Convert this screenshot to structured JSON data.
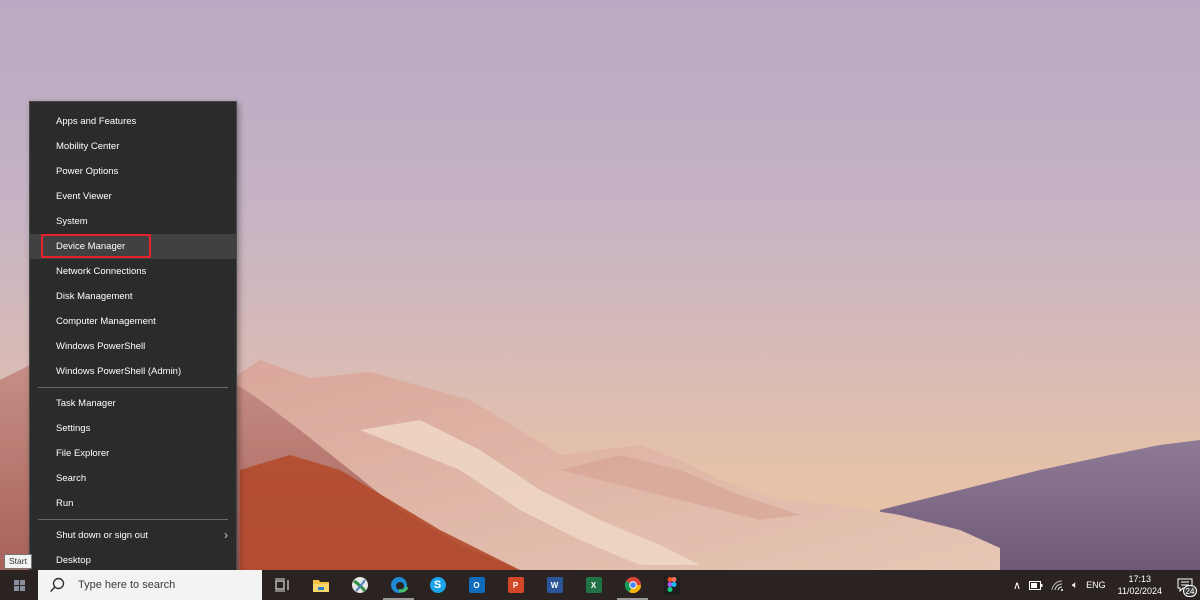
{
  "desktop": {
    "wallpaper": "landscape-hills-sunset"
  },
  "winx_menu": {
    "groups": [
      [
        {
          "label": "Apps and Features"
        },
        {
          "label": "Mobility Center"
        },
        {
          "label": "Power Options"
        },
        {
          "label": "Event Viewer"
        },
        {
          "label": "System"
        },
        {
          "label": "Device Manager",
          "highlighted": true
        },
        {
          "label": "Network Connections"
        },
        {
          "label": "Disk Management"
        },
        {
          "label": "Computer Management"
        },
        {
          "label": "Windows PowerShell"
        },
        {
          "label": "Windows PowerShell (Admin)"
        }
      ],
      [
        {
          "label": "Task Manager"
        },
        {
          "label": "Settings"
        },
        {
          "label": "File Explorer"
        },
        {
          "label": "Search"
        },
        {
          "label": "Run"
        }
      ],
      [
        {
          "label": "Shut down or sign out",
          "has_submenu": true
        },
        {
          "label": "Desktop"
        }
      ]
    ],
    "highlight_color": "#e8212b"
  },
  "tooltip": {
    "start": "Start"
  },
  "taskbar": {
    "search_placeholder": "Type here to search",
    "apps": [
      {
        "name": "Task View",
        "icon": "task-view-icon"
      },
      {
        "name": "File Explorer",
        "icon": "file-explorer-icon"
      },
      {
        "name": "Xbox",
        "icon": "xbox-icon"
      },
      {
        "name": "Microsoft Edge",
        "icon": "edge-icon",
        "running": true
      },
      {
        "name": "Skype",
        "icon": "skype-icon"
      },
      {
        "name": "Outlook",
        "icon": "outlook-icon"
      },
      {
        "name": "PowerPoint",
        "icon": "powerpoint-icon"
      },
      {
        "name": "Word",
        "icon": "word-icon"
      },
      {
        "name": "Excel",
        "icon": "excel-icon"
      },
      {
        "name": "Google Chrome",
        "icon": "chrome-icon",
        "running": true
      },
      {
        "name": "Figma",
        "icon": "figma-icon"
      }
    ],
    "tray": {
      "language": "ENG",
      "time": "17:13",
      "date": "11/02/2024",
      "notification_count": "24"
    }
  }
}
